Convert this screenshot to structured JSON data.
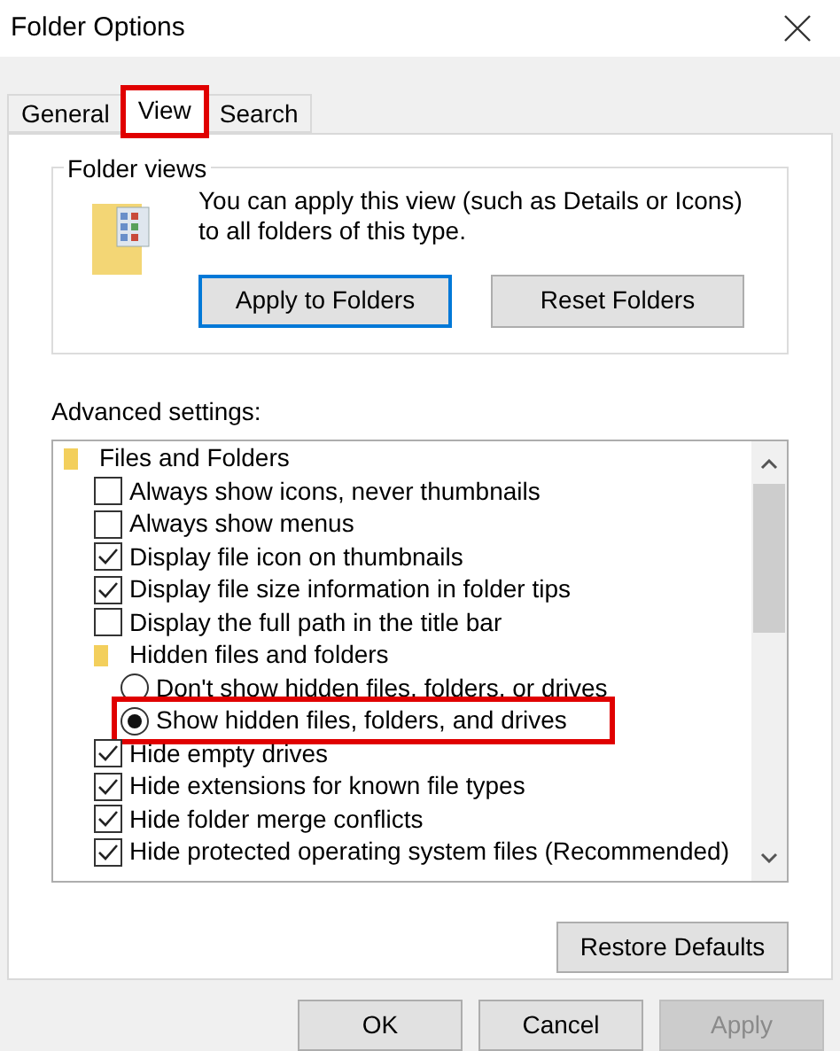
{
  "window": {
    "title": "Folder Options"
  },
  "tabs": [
    {
      "label": "General",
      "selected": false,
      "highlighted": false
    },
    {
      "label": "View",
      "selected": true,
      "highlighted": true
    },
    {
      "label": "Search",
      "selected": false,
      "highlighted": false
    }
  ],
  "folder_views": {
    "title": "Folder views",
    "text": "You can apply this view (such as Details or Icons) to all folders of this type.",
    "buttons": [
      {
        "label": "Apply to Folders",
        "focused": true
      },
      {
        "label": "Reset Folders",
        "focused": false
      }
    ]
  },
  "advanced_settings": {
    "label": "Advanced settings:",
    "items": [
      {
        "kind": "group",
        "label": "Files and Folders",
        "children": [
          {
            "kind": "checkbox",
            "label": "Always show icons, never thumbnails",
            "checked": false,
            "highlighted": false
          },
          {
            "kind": "checkbox",
            "label": "Always show menus",
            "checked": false,
            "highlighted": false
          },
          {
            "kind": "checkbox",
            "label": "Display file icon on thumbnails",
            "checked": true,
            "highlighted": false
          },
          {
            "kind": "checkbox",
            "label": "Display file size information in folder tips",
            "checked": true,
            "highlighted": false
          },
          {
            "kind": "checkbox",
            "label": "Display the full path in the title bar",
            "checked": false,
            "highlighted": false
          },
          {
            "kind": "group",
            "label": "Hidden files and folders",
            "children": [
              {
                "kind": "radio",
                "label": "Don't show hidden files, folders, or drives",
                "selected": false,
                "highlighted": false
              },
              {
                "kind": "radio",
                "label": "Show hidden files, folders, and drives",
                "selected": true,
                "highlighted": true
              }
            ]
          },
          {
            "kind": "checkbox",
            "label": "Hide empty drives",
            "checked": true,
            "highlighted": false
          },
          {
            "kind": "checkbox",
            "label": "Hide extensions for known file types",
            "checked": true,
            "highlighted": false
          },
          {
            "kind": "checkbox",
            "label": "Hide folder merge conflicts",
            "checked": true,
            "highlighted": false
          },
          {
            "kind": "checkbox",
            "label": "Hide protected operating system files (Recommended)",
            "checked": true,
            "highlighted": false
          }
        ]
      }
    ]
  },
  "restore_button": {
    "label": "Restore Defaults"
  },
  "footer_buttons": [
    {
      "label": "OK",
      "disabled": false
    },
    {
      "label": "Cancel",
      "disabled": false
    },
    {
      "label": "Apply",
      "disabled": true
    }
  ]
}
